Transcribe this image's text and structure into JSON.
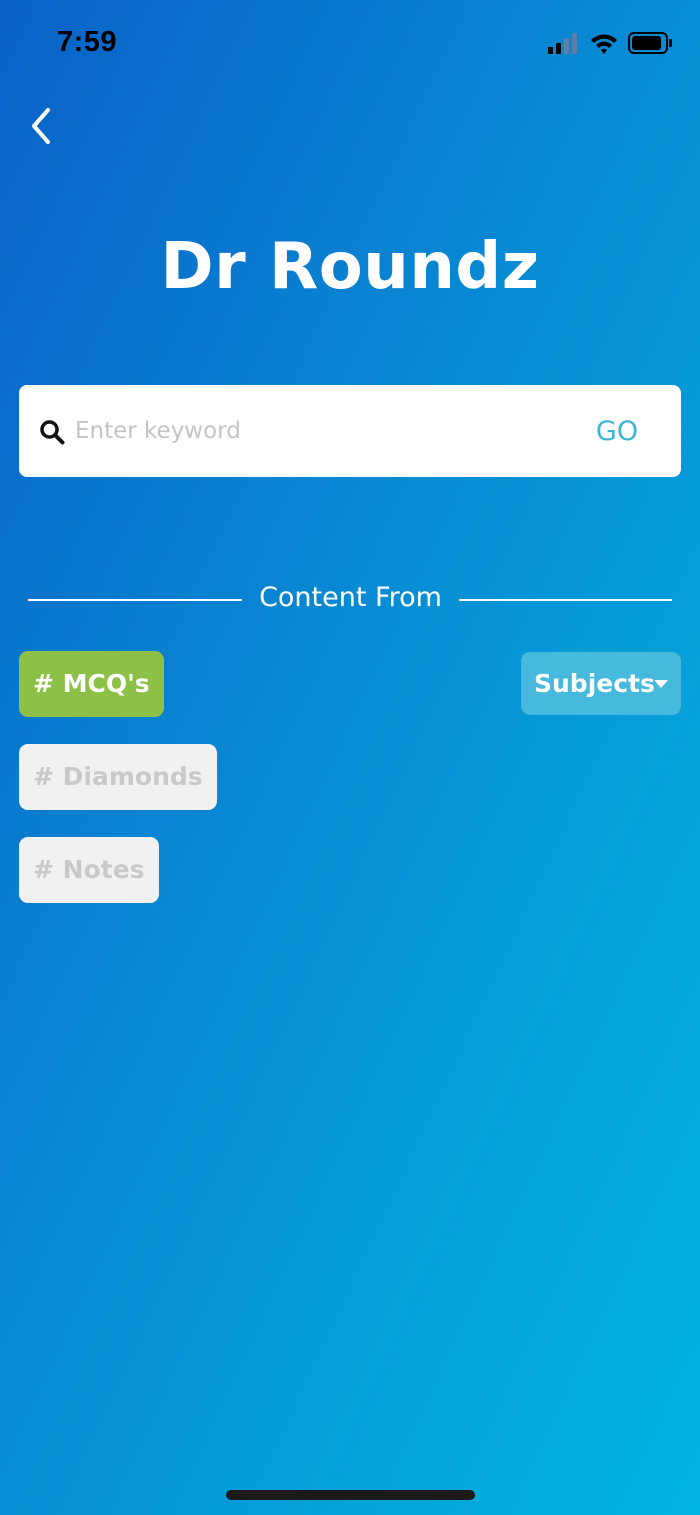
{
  "status_bar": {
    "time": "7:59",
    "signal_icon": "cellular-signal-icon",
    "wifi_icon": "wifi-icon",
    "battery_icon": "battery-icon"
  },
  "nav": {
    "back_icon": "chevron-left-icon"
  },
  "header": {
    "title": "Dr Roundz"
  },
  "search": {
    "icon": "search-icon",
    "placeholder": "Enter keyword",
    "value": "",
    "go_label": "GO",
    "go_color": "#3bb4d8"
  },
  "content_from": {
    "label": "Content From",
    "chips": [
      {
        "label": "# MCQ's",
        "selected": true
      },
      {
        "label": "# Diamonds",
        "selected": false
      },
      {
        "label": "# Notes",
        "selected": false
      }
    ],
    "subjects_dropdown": {
      "label": "Subjects",
      "icon": "caret-down-icon"
    }
  },
  "colors": {
    "background_start": "#0a61c8",
    "background_end": "#01b5e2",
    "chip_active": "#8dc046",
    "chip_inactive": "#f1f1f1",
    "dropdown_bg": "#47b9dc"
  }
}
